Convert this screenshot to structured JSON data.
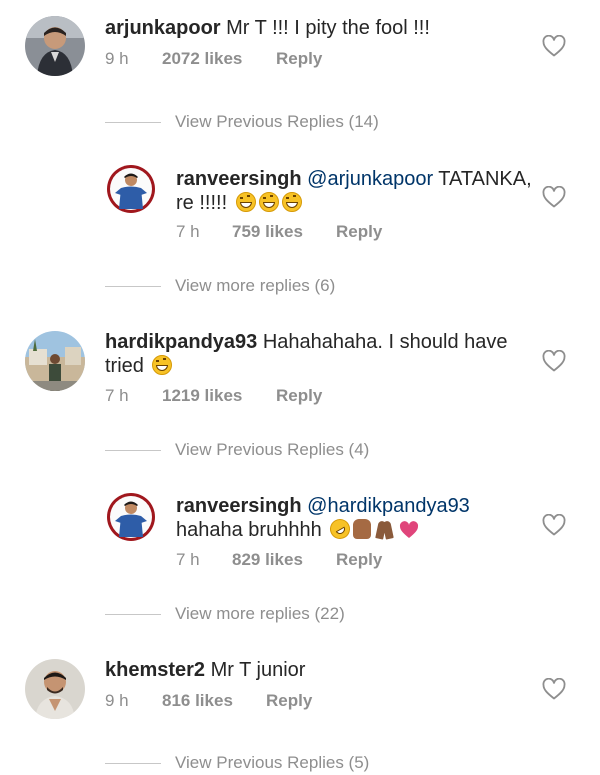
{
  "comments": [
    {
      "username": "arjunkapoor",
      "text": " Mr T !!! I pity the fool !!!",
      "time": "9 h",
      "likes": "2072 likes",
      "reply": "Reply"
    },
    {
      "username": "ranveersingh",
      "mention": "@arjunkapoor",
      "text_line1": " TATANKA,",
      "text_line2": "re !!!!!",
      "emojis": [
        "grinning-squinting-face",
        "grinning-squinting-face",
        "grinning-squinting-face"
      ],
      "time": "7 h",
      "likes": "759 likes",
      "reply": "Reply"
    },
    {
      "username": "hardikpandya93",
      "text_line1": " Hahahahaha. I should have",
      "text_line2": "tried",
      "emojis": [
        "grinning-squinting-face"
      ],
      "time": "7 h",
      "likes": "1219 likes",
      "reply": "Reply"
    },
    {
      "username": "ranveersingh",
      "mention": "@hardikpandya93",
      "text_line2": "hahaha bruhhhh",
      "emojis": [
        "rolling-on-floor-laughing",
        "raised-fist",
        "folded-hands",
        "pink-heart"
      ],
      "time": "7 h",
      "likes": "829 likes",
      "reply": "Reply"
    },
    {
      "username": "khemster2",
      "text": " Mr T junior",
      "time": "9 h",
      "likes": "816 likes",
      "reply": "Reply"
    }
  ],
  "view_rows": [
    "View Previous Replies (14)",
    "View more replies (6)",
    "View Previous Replies (4)",
    "View more replies (22)",
    "View Previous Replies (5)"
  ],
  "icons": {
    "like": "heart-outline-icon"
  },
  "colors": {
    "text": "#262626",
    "meta": "#8e8e8e",
    "mention": "#003569",
    "divider": "#c7c7c7"
  }
}
